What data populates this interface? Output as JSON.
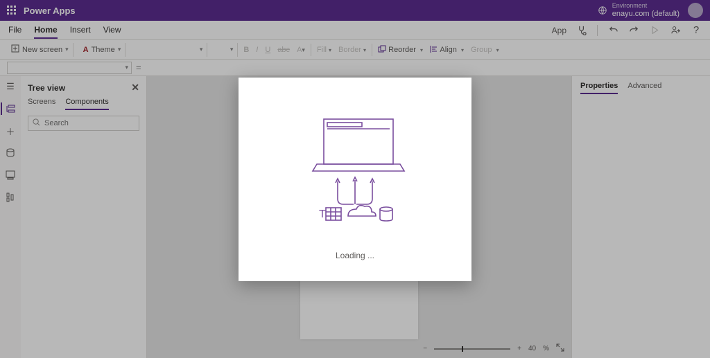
{
  "titlebar": {
    "app_name": "Power Apps",
    "env_label": "Environment",
    "env_value": "enayu.com (default)"
  },
  "menubar": {
    "items": [
      "File",
      "Home",
      "Insert",
      "View"
    ],
    "selected": 1,
    "app_pill": "App"
  },
  "ribbon": {
    "new_screen": "New screen",
    "theme": "Theme",
    "fill": "Fill",
    "border": "Border",
    "reorder": "Reorder",
    "align": "Align",
    "group": "Group"
  },
  "tree": {
    "title": "Tree view",
    "tabs": [
      "Screens",
      "Components"
    ],
    "selected_tab": 1,
    "search_placeholder": "Search"
  },
  "props": {
    "tabs": [
      "Properties",
      "Advanced"
    ],
    "selected": 0
  },
  "zoom": {
    "minus": "−",
    "plus": "+",
    "value": "40",
    "unit": "%"
  },
  "modal": {
    "text": "Loading ..."
  },
  "icons": {
    "waffle": "waffle-icon",
    "env": "globe-icon",
    "avatar": "avatar",
    "stethoscope": "diagnostics-icon",
    "undo": "undo-icon",
    "redo": "redo-icon",
    "play": "play-icon",
    "share": "share-icon",
    "help": "help-icon",
    "tree": "tree-icon",
    "insert": "plus-icon",
    "data": "data-icon",
    "media": "media-icon",
    "advanced": "advanced-icon",
    "search": "search-icon",
    "close": "close-icon",
    "expand": "expand-icon"
  }
}
